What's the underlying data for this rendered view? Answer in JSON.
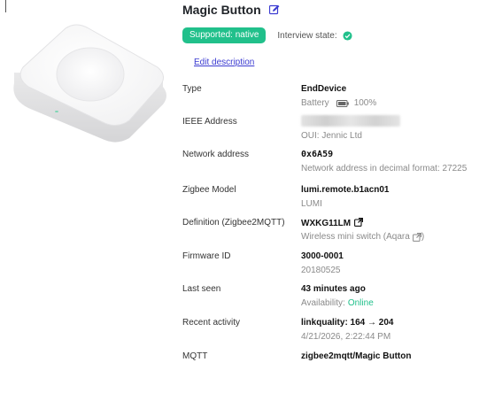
{
  "device": {
    "title": "Magic Button",
    "supported_badge": "Supported: native",
    "interview_label": "Interview state:",
    "edit_description": "Edit description"
  },
  "colors": {
    "accent_green": "#21c08b",
    "link_purple": "#3b3bd1"
  },
  "icons": {
    "edit": "edit-icon",
    "interview": "check-circle-icon",
    "battery": "battery-icon",
    "external": "external-link-icon"
  },
  "rows": {
    "type": {
      "label": "Type",
      "value": "EndDevice",
      "sub_prefix": "Battery",
      "sub_suffix": "100%"
    },
    "ieee": {
      "label": "IEEE Address",
      "sub": "OUI: Jennic Ltd"
    },
    "network": {
      "label": "Network address",
      "value": "0x6A59",
      "sub": "Network address in decimal format: 27225"
    },
    "model": {
      "label": "Zigbee Model",
      "value": "lumi.remote.b1acn01",
      "sub": "LUMI"
    },
    "definition": {
      "label": "Definition (Zigbee2MQTT)",
      "value": "WXKG11LM",
      "sub": "Wireless mini switch (Aqara",
      "sub_close": ")"
    },
    "firmware": {
      "label": "Firmware ID",
      "value": "3000-0001",
      "sub": "20180525"
    },
    "last_seen": {
      "label": "Last seen",
      "value": "43 minutes ago",
      "sub_prefix": "Availability:",
      "status": "Online"
    },
    "activity": {
      "label": "Recent activity",
      "value": "linkquality: 164 → 204",
      "sub": "4/21/2026, 2:22:44 PM"
    },
    "mqtt": {
      "label": "MQTT",
      "value": "zigbee2mqtt/Magic Button"
    }
  }
}
